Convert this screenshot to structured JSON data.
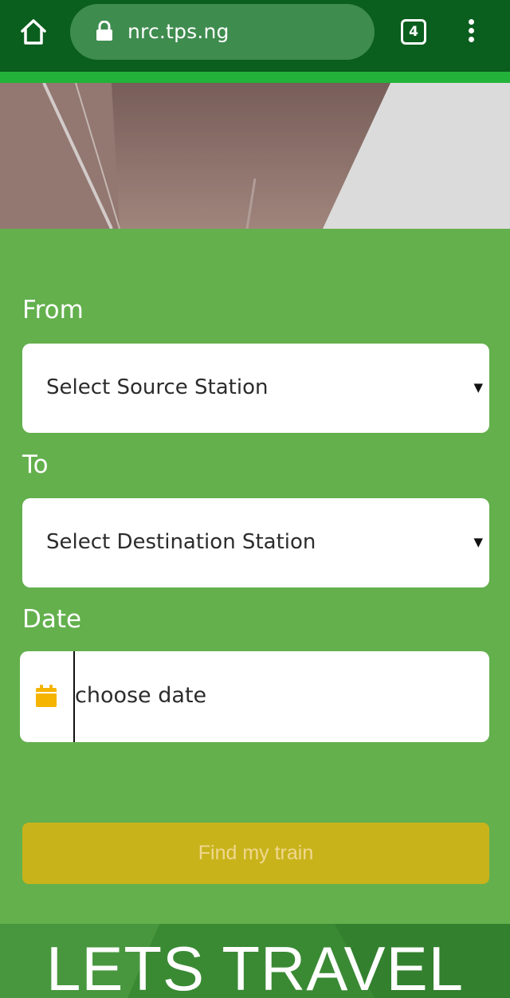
{
  "browser": {
    "url": "nrc.tps.ng",
    "tab_count": "4"
  },
  "form": {
    "from_label": "From",
    "from_placeholder": "Select Source Station",
    "to_label": "To",
    "to_placeholder": "Select Destination Station",
    "date_label": "Date",
    "date_placeholder": "choose date",
    "submit_label": "Find my train"
  },
  "banner": {
    "title": "LETS TRAVEL"
  },
  "colors": {
    "chrome": "#0a5e1e",
    "page_green": "#63b04d",
    "button": "#c9b31b",
    "calendar_icon": "#f5b400"
  }
}
